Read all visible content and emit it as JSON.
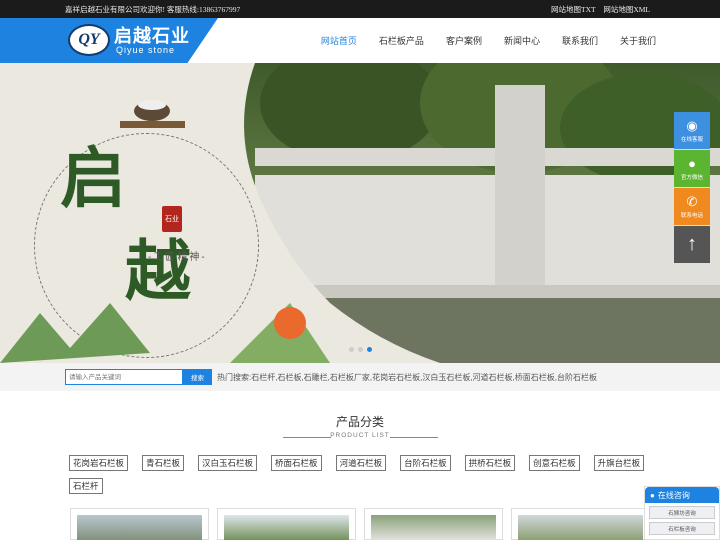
{
  "topbar": {
    "welcome": "嘉祥启越石业有限公司欢迎你!  客服热线:13863767997",
    "links": [
      "网站地图TXT",
      "网站地图XML"
    ]
  },
  "logo": {
    "emblem": "QY",
    "cn": "启越石业",
    "en": "Qiyue stone"
  },
  "nav": {
    "items": [
      "网站首页",
      "石栏板产品",
      "客户案例",
      "新闻中心",
      "联系我们",
      "关于我们"
    ],
    "active": "网站首页"
  },
  "banner": {
    "char1": "启",
    "char2": "越",
    "motto": "-工匠精神-",
    "seal": "石业",
    "slides": 3,
    "active_slide": 3
  },
  "float": {
    "items": [
      {
        "label": "在线客服",
        "icon": "qq-icon",
        "color": "#3d8fe0"
      },
      {
        "label": "官方微信",
        "icon": "wechat-icon",
        "color": "#5cb531"
      },
      {
        "label": "联系电话",
        "icon": "phone-icon",
        "color": "#f08a1f"
      },
      {
        "label": "",
        "icon": "arrow-up-icon",
        "color": "#555555"
      }
    ]
  },
  "search": {
    "placeholder": "请输入产品关键词",
    "button": "搜索",
    "hot": "热门搜索:石栏杆,石栏板,石雕栏,石栏板厂家,花岗岩石栏板,汉白玉石栏板,河道石栏板,桥面石栏板,台阶石栏板"
  },
  "products": {
    "title": "产品分类",
    "subtitle": "PRODUCT LIST",
    "categories": [
      "花岗岩石栏板",
      "青石栏板",
      "汉白玉石栏板",
      "桥面石栏板",
      "河道石栏板",
      "台阶石栏板",
      "拱桥石栏板",
      "创意石栏板",
      "升旗台栏板",
      "石栏杆"
    ]
  },
  "chat": {
    "title": "在线咨询",
    "options": [
      "石狮坊咨询",
      "石栏板咨询"
    ]
  },
  "colors": {
    "accent": "#1e82e0",
    "topbar": "#1b1b1b"
  }
}
